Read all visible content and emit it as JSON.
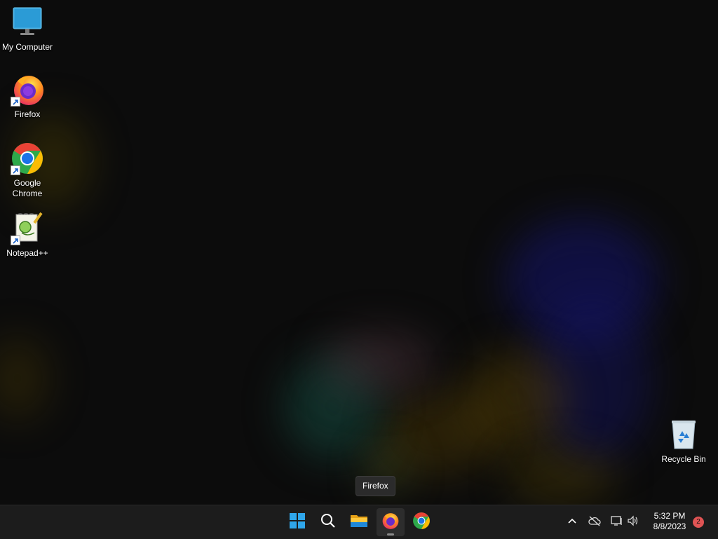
{
  "desktop": {
    "icons": [
      {
        "label": "My Computer",
        "icon": "monitor-icon"
      },
      {
        "label": "Firefox",
        "icon": "firefox-icon"
      },
      {
        "label": "Google Chrome",
        "icon": "chrome-icon"
      },
      {
        "label": "Notepad++",
        "icon": "notepadpp-icon"
      },
      {
        "label": "Recycle Bin",
        "icon": "recycle-bin-icon"
      }
    ]
  },
  "tooltip": {
    "text": "Firefox"
  },
  "taskbar": {
    "pinned": [
      "start-icon",
      "search-icon",
      "file-explorer-icon",
      "firefox-icon",
      "chrome-icon"
    ],
    "active": "firefox",
    "tray": {
      "icons": [
        "chevron-up-icon",
        "cloud-off-icon",
        "network-icon",
        "volume-icon"
      ],
      "time": "5:32 PM",
      "date": "8/8/2023",
      "notification_count": "2"
    }
  },
  "colors": {
    "taskbar_bg": "#1c1c1c",
    "desktop_bg": "#0c0c0c",
    "badge": "#e05454"
  }
}
